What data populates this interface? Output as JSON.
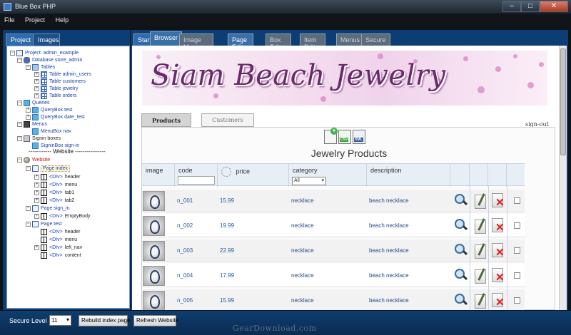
{
  "window": {
    "title": "Blue Box PHP",
    "controls": [
      "–",
      "□",
      "✕"
    ]
  },
  "menubar": {
    "items": [
      "File",
      "Project",
      "Help"
    ]
  },
  "left_tabs": [
    "Project",
    "Images"
  ],
  "tree": {
    "project": "Project: admin_example",
    "database": "Database store_admin",
    "tables_folder": "Tables",
    "tables": [
      "Table admin_users",
      "Table customers",
      "Table jewelry",
      "Table orders"
    ],
    "queries_folder": "Queries",
    "queries": [
      "QueryBox test",
      "QueryBox date_test"
    ],
    "menus_folder": "Menus",
    "menus": [
      "MenuBox nav"
    ],
    "signin_folder": "Signin boxes",
    "signins": [
      "SigninBox sign-in"
    ],
    "separator": "------------ Website ----------------",
    "website": "Website",
    "page_index": "Page index",
    "page_index_divs": [
      "header",
      "menu",
      "tab1",
      "tab2"
    ],
    "page_signin": "Page sign_in",
    "page_signin_divs": [
      "EmptyBody"
    ],
    "page_test": "Page test",
    "page_test_divs": [
      "header",
      "menu",
      "left_nav",
      "content"
    ],
    "div_tag": "<DIv>"
  },
  "right_tabs": [
    "Start",
    "Browser",
    "Image Manager",
    "Page Editor",
    "Box Editor",
    "Item Editor",
    "Menus",
    "Secure"
  ],
  "browser": {
    "banner_title": "Siam Beach Jewelry",
    "signout": "sign-out",
    "content_tabs": [
      "Products",
      "Customers"
    ],
    "export_icons": [
      "add-icon",
      "csv-icon",
      "xml-icon"
    ],
    "export_badges": [
      "+",
      "CSV",
      "XML"
    ],
    "table_title": "Jewelry Products",
    "columns": [
      "image",
      "code",
      "price",
      "category",
      "description"
    ],
    "category_filter": "All",
    "rows": [
      {
        "code": "n_001",
        "price": "15.99",
        "category": "necklace",
        "description": "beach necklace"
      },
      {
        "code": "n_002",
        "price": "19.99",
        "category": "necklace",
        "description": "beach necklace"
      },
      {
        "code": "n_003",
        "price": "22.99",
        "category": "necklace",
        "description": "beach necklace"
      },
      {
        "code": "n_004",
        "price": "17.99",
        "category": "necklace",
        "description": "beach necklace"
      },
      {
        "code": "n_005",
        "price": "15.99",
        "category": "necklace",
        "description": "beach necklace"
      }
    ]
  },
  "bottom": {
    "secure_label": "Secure Level",
    "secure_value": "11",
    "rebuild_button": "Rebuild index page",
    "refresh_button": "Refresh Website"
  },
  "watermark": "GearDownload.com"
}
